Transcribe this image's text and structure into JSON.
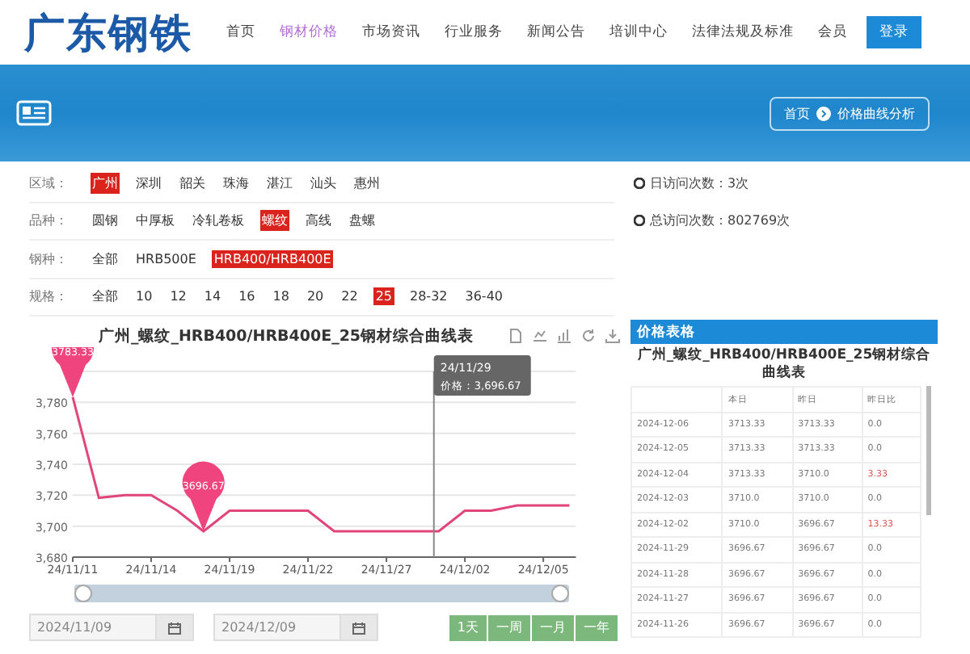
{
  "header": {
    "logo": "广东钢铁",
    "nav": [
      {
        "label": "首页",
        "selected": false
      },
      {
        "label": "钢材价格",
        "selected": true
      },
      {
        "label": "市场资讯",
        "selected": false
      },
      {
        "label": "行业服务",
        "selected": false
      },
      {
        "label": "新闻公告",
        "selected": false
      },
      {
        "label": "培训中心",
        "selected": false
      },
      {
        "label": "法律法规及标准",
        "selected": false
      },
      {
        "label": "会员",
        "selected": false
      }
    ],
    "login": "登录"
  },
  "banner": {
    "breadcrumb": [
      "首页",
      "价格曲线分析"
    ]
  },
  "filters": [
    {
      "label": "区域：",
      "options": [
        {
          "label": "广州",
          "selected": true
        },
        {
          "label": "深圳",
          "selected": false
        },
        {
          "label": "韶关",
          "selected": false
        },
        {
          "label": "珠海",
          "selected": false
        },
        {
          "label": "湛江",
          "selected": false
        },
        {
          "label": "汕头",
          "selected": false
        },
        {
          "label": "惠州",
          "selected": false
        }
      ]
    },
    {
      "label": "品种：",
      "options": [
        {
          "label": "圆钢",
          "selected": false
        },
        {
          "label": "中厚板",
          "selected": false
        },
        {
          "label": "冷轧卷板",
          "selected": false
        },
        {
          "label": "螺纹",
          "selected": true
        },
        {
          "label": "高线",
          "selected": false
        },
        {
          "label": "盘螺",
          "selected": false
        }
      ]
    },
    {
      "label": "钢种：",
      "options": [
        {
          "label": "全部",
          "selected": false
        },
        {
          "label": "HRB500E",
          "selected": false
        },
        {
          "label": "HRB400/HRB400E",
          "selected": true
        }
      ]
    },
    {
      "label": "规格：",
      "options": [
        {
          "label": "全部",
          "selected": false
        },
        {
          "label": "10",
          "selected": false
        },
        {
          "label": "12",
          "selected": false
        },
        {
          "label": "14",
          "selected": false
        },
        {
          "label": "16",
          "selected": false
        },
        {
          "label": "18",
          "selected": false
        },
        {
          "label": "20",
          "selected": false
        },
        {
          "label": "22",
          "selected": false
        },
        {
          "label": "25",
          "selected": true
        },
        {
          "label": "28-32",
          "selected": false
        },
        {
          "label": "36-40",
          "selected": false
        }
      ]
    }
  ],
  "stats": [
    "日访问次数：3次",
    "总访问次数：802769次"
  ],
  "chart": {
    "chart_data": {
      "type": "line",
      "title": "广州_螺纹_HRB400/HRB400E_25钢材综合曲线表",
      "categories": [
        "24/11/11",
        null,
        null,
        "24/11/14",
        null,
        null,
        "24/11/19",
        null,
        null,
        "24/11/22",
        null,
        null,
        "24/11/27",
        null,
        null,
        "24/12/02",
        null,
        null,
        "24/12/05",
        null
      ],
      "series": [
        {
          "name": "价格",
          "color": "#e0457b",
          "values": [
            3783.33,
            3718.33,
            3720,
            3720,
            3710,
            3696.67,
            3710,
            3710,
            3710,
            3710,
            3696.67,
            3696.67,
            3696.67,
            3696.67,
            3696.67,
            3710,
            3710,
            3713.33,
            3713.33,
            3713.33
          ]
        }
      ],
      "ylim": [
        3680,
        3800
      ],
      "yticks": [
        {
          "value": 3680,
          "label": "3,680"
        },
        {
          "value": 3700,
          "label": "3,700"
        },
        {
          "value": 3720,
          "label": "3,720"
        },
        {
          "value": 3740,
          "label": "3,740"
        },
        {
          "value": 3760,
          "label": "3,760"
        },
        {
          "value": 3780,
          "label": "3,780"
        }
      ],
      "grid": true,
      "annotations": [
        "3783.33",
        "3696.67"
      ]
    },
    "tooltip": {
      "title": "24/11/29",
      "value": "：3,696.67"
    },
    "range": {
      "level": 1
    },
    "start_date": "2024/11/09",
    "end_date": "2024/12/09",
    "ranges": [
      "1天",
      "一周",
      "一月",
      "一年"
    ]
  },
  "table": {
    "header": "价格表格",
    "title": "广州_螺纹_HRB400/HRB400E_25钢材综合曲线表",
    "columns": [
      "本日",
      "昨日",
      "昨日比"
    ],
    "rows": [
      {
        "date": "2024-12-06",
        "today": "3713.33",
        "yesterday": "3713.33",
        "change": "0.0",
        "up": false
      },
      {
        "date": "2024-12-05",
        "today": "3713.33",
        "yesterday": "3713.33",
        "change": "0.0",
        "up": false
      },
      {
        "date": "2024-12-04",
        "today": "3713.33",
        "yesterday": "3710.0",
        "change": "3.33",
        "up": true
      },
      {
        "date": "2024-12-03",
        "today": "3710.0",
        "yesterday": "3710.0",
        "change": "0.0",
        "up": false
      },
      {
        "date": "2024-12-02",
        "today": "3710.0",
        "yesterday": "3696.67",
        "change": "13.33",
        "up": true
      },
      {
        "date": "2024-11-29",
        "today": "3696.67",
        "yesterday": "3696.67",
        "change": "0.0",
        "up": false
      },
      {
        "date": "2024-11-28",
        "today": "3696.67",
        "yesterday": "3696.67",
        "change": "0.0",
        "up": false
      },
      {
        "date": "2024-11-27",
        "today": "3696.67",
        "yesterday": "3696.67",
        "change": "0.0",
        "up": false
      },
      {
        "date": "2024-11-26",
        "today": "3696.67",
        "yesterday": "3696.67",
        "change": "0.0",
        "up": false
      }
    ]
  }
}
